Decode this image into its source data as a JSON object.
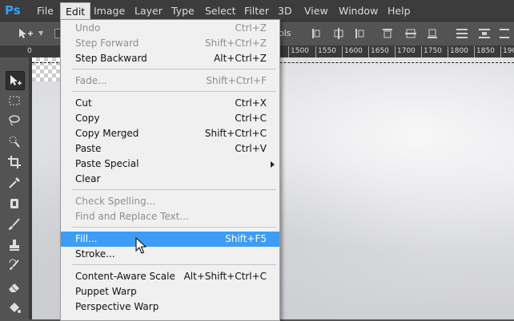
{
  "app": {
    "logo": "Ps",
    "accent": "#2fa3f7"
  },
  "menubar": {
    "items": [
      {
        "label": "File"
      },
      {
        "label": "Edit",
        "active": true
      },
      {
        "label": "Image"
      },
      {
        "label": "Layer"
      },
      {
        "label": "Type"
      },
      {
        "label": "Select"
      },
      {
        "label": "Filter"
      },
      {
        "label": "3D"
      },
      {
        "label": "View"
      },
      {
        "label": "Window"
      },
      {
        "label": "Help"
      }
    ]
  },
  "options_bar": {
    "tool_icon": "move-tool-icon",
    "label_fragment": "ols"
  },
  "ruler": {
    "labels": [
      "0",
      "1500",
      "1550",
      "1600",
      "1650",
      "1700",
      "1750",
      "1800",
      "1850",
      "1900"
    ]
  },
  "edit_menu": {
    "items": [
      {
        "label": "Undo",
        "shortcut": "Ctrl+Z",
        "disabled": true
      },
      {
        "label": "Step Forward",
        "shortcut": "Shift+Ctrl+Z",
        "disabled": true
      },
      {
        "label": "Step Backward",
        "shortcut": "Alt+Ctrl+Z",
        "disabled": false
      },
      {
        "label": "Fade...",
        "shortcut": "Shift+Ctrl+F",
        "disabled": true
      },
      {
        "label": "Cut",
        "shortcut": "Ctrl+X",
        "disabled": false
      },
      {
        "label": "Copy",
        "shortcut": "Ctrl+C",
        "disabled": false
      },
      {
        "label": "Copy Merged",
        "shortcut": "Shift+Ctrl+C",
        "disabled": false
      },
      {
        "label": "Paste",
        "shortcut": "Ctrl+V",
        "disabled": false
      },
      {
        "label": "Paste Special",
        "shortcut": "",
        "disabled": false,
        "submenu": true
      },
      {
        "label": "Clear",
        "shortcut": "",
        "disabled": false
      },
      {
        "label": "Check Spelling...",
        "shortcut": "",
        "disabled": true
      },
      {
        "label": "Find and Replace Text...",
        "shortcut": "",
        "disabled": true
      },
      {
        "label": "Fill...",
        "shortcut": "Shift+F5",
        "disabled": false,
        "highlighted": true
      },
      {
        "label": "Stroke...",
        "shortcut": "",
        "disabled": false
      },
      {
        "label": "Content-Aware Scale",
        "shortcut": "Alt+Shift+Ctrl+C",
        "disabled": false
      },
      {
        "label": "Puppet Warp",
        "shortcut": "",
        "disabled": false
      },
      {
        "label": "Perspective Warp",
        "shortcut": "",
        "disabled": false
      }
    ]
  },
  "toolbar": {
    "tools": [
      "move-tool-icon",
      "marquee-tool-icon",
      "lasso-tool-icon",
      "quick-selection-tool-icon",
      "crop-tool-icon",
      "eyedropper-tool-icon",
      "spot-healing-tool-icon",
      "brush-tool-icon",
      "clone-stamp-tool-icon",
      "history-brush-tool-icon",
      "eraser-tool-icon",
      "paint-bucket-tool-icon"
    ]
  },
  "colors": {
    "menu_highlight": "#3d9cf5",
    "chrome_dark": "#3c3c3c",
    "panel": "#535353"
  }
}
